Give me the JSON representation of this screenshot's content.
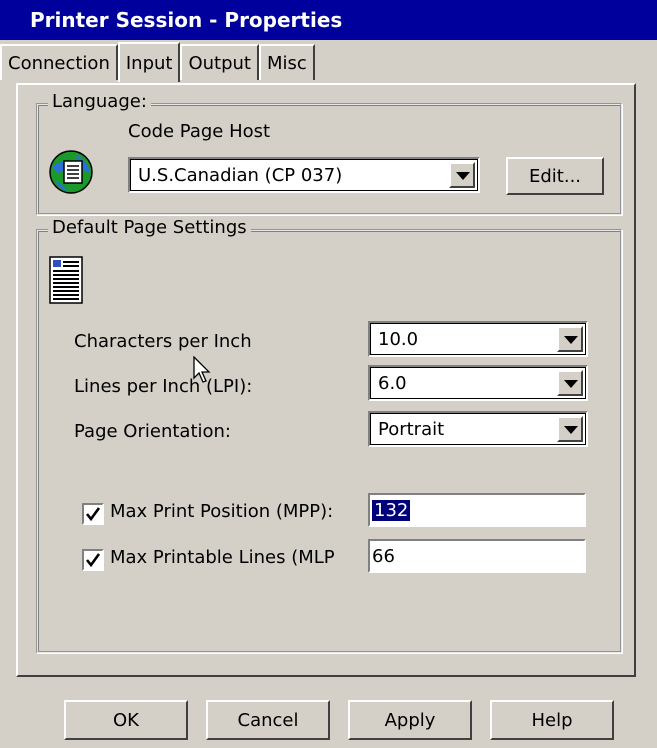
{
  "window": {
    "title": "Printer Session - Properties"
  },
  "tabs": [
    {
      "label": "Connection"
    },
    {
      "label": "Input"
    },
    {
      "label": "Output"
    },
    {
      "label": "Misc"
    }
  ],
  "language_group": {
    "legend": "Language:",
    "code_page_label": "Code Page Host",
    "code_page_value": "U.S.Canadian (CP 037)",
    "edit_button": "Edit..."
  },
  "page_settings": {
    "legend": "Default Page Settings",
    "cpi_label": "Characters per Inch",
    "cpi_value": "10.0",
    "lpi_label": "Lines per Inch (LPI):",
    "lpi_value": "6.0",
    "orientation_label": "Page Orientation:",
    "orientation_value": "Portrait",
    "mpp_checked": true,
    "mpp_label": "Max Print Position (MPP):",
    "mpp_value": "132",
    "mpl_checked": true,
    "mpl_label": "Max Printable Lines (MLP",
    "mpl_value": "66"
  },
  "buttons": {
    "ok": "OK",
    "cancel": "Cancel",
    "apply": "Apply",
    "help": "Help"
  },
  "icons": [
    "globe-document-icon",
    "page-document-icon",
    "dropdown-arrow-icon",
    "checkmark-icon",
    "mouse-cursor-icon"
  ]
}
